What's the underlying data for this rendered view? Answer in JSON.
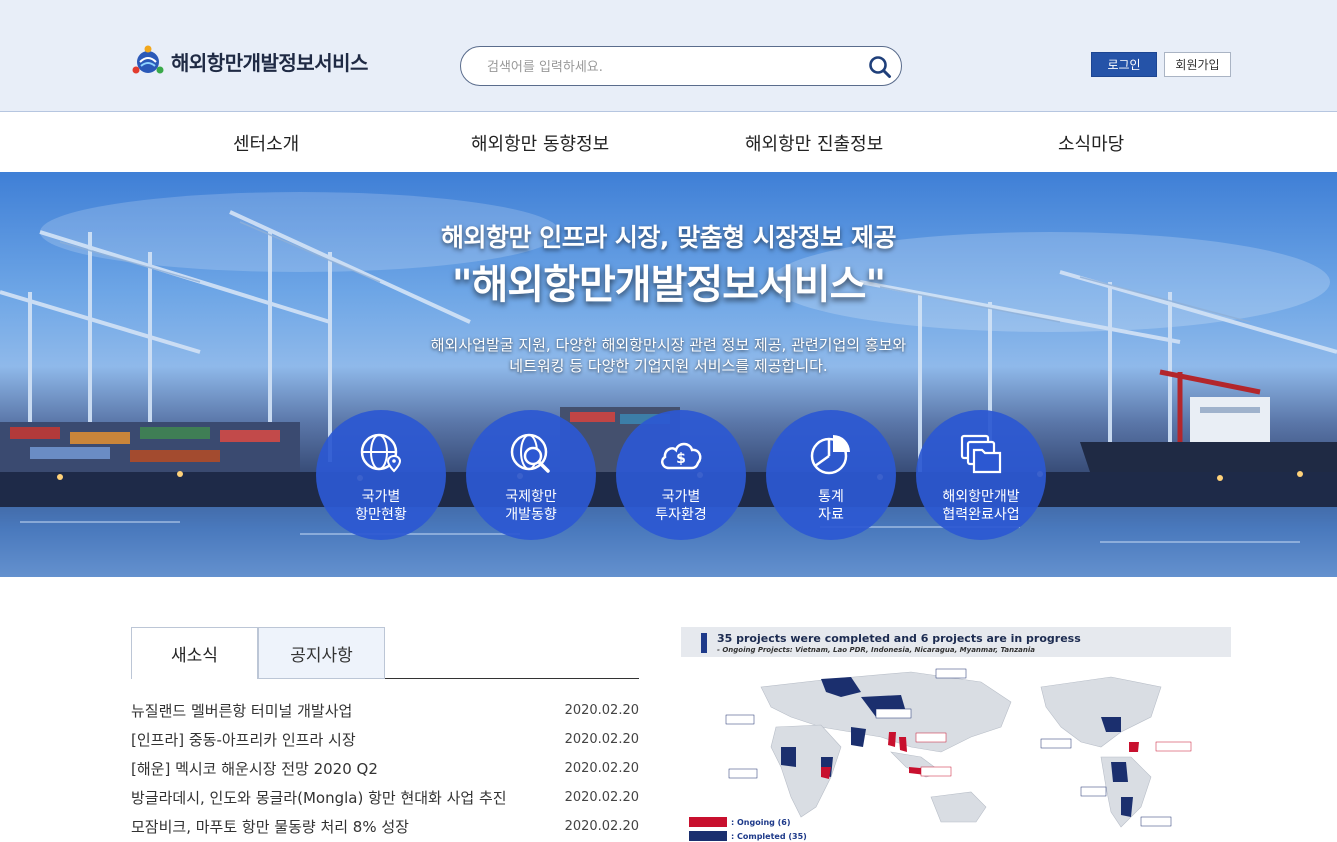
{
  "header": {
    "logo_text": "해외항만개발정보서비스",
    "search_placeholder": "검색어를 입력하세요.",
    "login_label": "로그인",
    "join_label": "회원가입"
  },
  "nav": {
    "items": [
      "센터소개",
      "해외항만 동향정보",
      "해외항만 진출정보",
      "소식마당"
    ]
  },
  "hero": {
    "title_line1": "해외항만 인프라 시장, 맞춤형 시장정보 제공",
    "title_line2": "\"해외항만개발정보서비스\"",
    "desc_line1": "해외사업발굴 지원, 다양한 해외항만시장 관련 정보 제공, 관련기업의 홍보와",
    "desc_line2": "네트워킹 등 다양한 기업지원 서비스를 제공합니다.",
    "circles": [
      {
        "line1": "국가별",
        "line2": "항만현황",
        "icon": "globe-pin-icon"
      },
      {
        "line1": "국제항만",
        "line2": "개발동향",
        "icon": "globe-search-icon"
      },
      {
        "line1": "국가별",
        "line2": "투자환경",
        "icon": "cloud-dollar-icon"
      },
      {
        "line1": "통계",
        "line2": "자료",
        "icon": "pie-chart-icon"
      },
      {
        "line1": "해외항만개발",
        "line2": "협력완료사업",
        "icon": "folders-icon"
      }
    ]
  },
  "news": {
    "tabs": [
      "새소식",
      "공지사항"
    ],
    "items": [
      {
        "title": "뉴질랜드 멜버른항 터미널 개발사업",
        "date": "2020.02.20"
      },
      {
        "title": "[인프라] 중동-아프리카 인프라 시장",
        "date": "2020.02.20"
      },
      {
        "title": "[해운] 멕시코 해운시장 전망 2020 Q2",
        "date": "2020.02.20"
      },
      {
        "title": "방글라데시, 인도와 몽글라(Mongla) 항만 현대화 사업 추진",
        "date": "2020.02.20"
      },
      {
        "title": "모잠비크, 마푸토 항만 물동량 처리 8% 성장",
        "date": "2020.02.20"
      }
    ]
  },
  "map": {
    "heading": "35 projects were completed and 6 projects are in progress",
    "subheading": "- Ongoing Projects: Vietnam, Lao PDR, Indonesia, Nicaragua, Myanmar, Tanzania",
    "legend_ongoing": ": Ongoing (6)",
    "legend_completed": ": Completed (35)",
    "colors": {
      "ongoing": "#c8102e",
      "completed": "#1b2f6e"
    }
  },
  "colors": {
    "accent": "#2553a8",
    "header_bg": "#e8eef8",
    "circle": "#2c58d2"
  }
}
